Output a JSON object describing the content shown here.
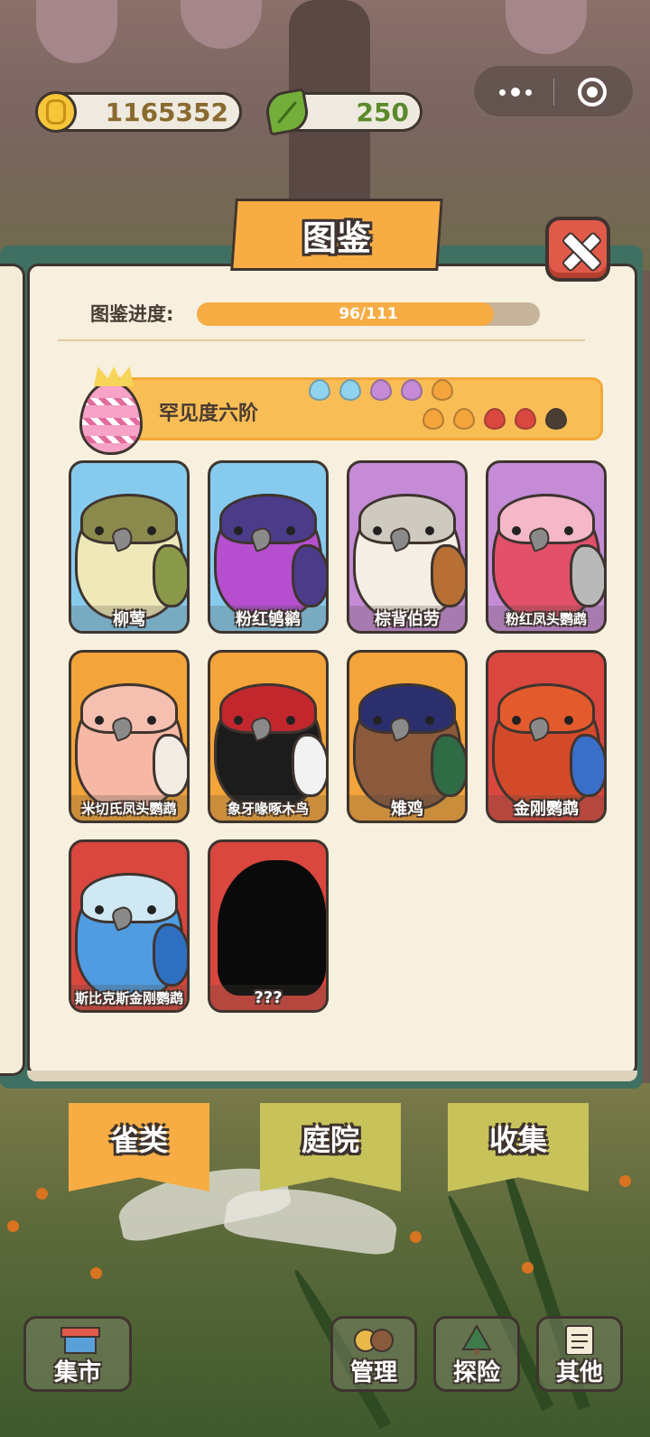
{
  "currency": {
    "coins": "1165352",
    "leaves": "250"
  },
  "pokedex": {
    "title": "图鉴",
    "progress_label": "图鉴进度:",
    "progress_text": "96/111",
    "progress_fraction": 0.865
  },
  "rarity": {
    "label": "罕见度六阶",
    "drop_colors": [
      "#8fd3ef",
      "#8fd3ef",
      "#c58bd6",
      "#c58bd6",
      "#f3a43a",
      "#f3a43a",
      "#f3a43a",
      "#d9473e",
      "#d9473e",
      "#4a3d33"
    ]
  },
  "birds": [
    {
      "name": "柳莺",
      "bg": "#86cbee",
      "body": "#efe8b9",
      "head": "#8a8a4c",
      "wing": "#8a9a4a",
      "found": true
    },
    {
      "name": "粉红鸲鹟",
      "bg": "#86cbee",
      "body": "#b54fcf",
      "head": "#4b3c8a",
      "wing": "#4b3c8a",
      "found": true
    },
    {
      "name": "棕背伯劳",
      "bg": "#c58bd6",
      "body": "#f4eee5",
      "head": "#cfcac0",
      "wing": "#b76f34",
      "found": true
    },
    {
      "name": "粉红凤头鹦鹉",
      "bg": "#c58bd6",
      "body": "#e2506a",
      "head": "#f4b8c8",
      "wing": "#b9b9b9",
      "found": true
    },
    {
      "name": "米切氏凤头鹦鹉",
      "bg": "#f3a43a",
      "body": "#f6b8a4",
      "head": "#f6c0b0",
      "wing": "#f2ebe4",
      "found": true
    },
    {
      "name": "象牙喙啄木鸟",
      "bg": "#f3a43a",
      "body": "#1c1c1c",
      "head": "#c1272d",
      "wing": "#f2f2f2",
      "found": true
    },
    {
      "name": "雉鸡",
      "bg": "#f3a43a",
      "body": "#8b5a3c",
      "head": "#2c2f6e",
      "wing": "#2f6b45",
      "found": true
    },
    {
      "name": "金刚鹦鹉",
      "bg": "#d9473e",
      "body": "#d24a2a",
      "head": "#e35a2c",
      "wing": "#3a6fc9",
      "found": true
    },
    {
      "name": "斯比克斯金刚鹦鹉",
      "bg": "#d9473e",
      "body": "#4f9ce0",
      "head": "#cfe8f4",
      "wing": "#2f6fbf",
      "found": true
    },
    {
      "name": "???",
      "bg": "#d9473e",
      "body": "#000000",
      "head": "#000000",
      "wing": "#000000",
      "found": false
    }
  ],
  "tabs": [
    {
      "label": "雀类",
      "active": true
    },
    {
      "label": "庭院",
      "active": false
    },
    {
      "label": "收集",
      "active": false
    }
  ],
  "nav": [
    {
      "label": "集市",
      "icon": "market-stall-icon"
    },
    {
      "label": "管理",
      "icon": "birds-manage-icon"
    },
    {
      "label": "探险",
      "icon": "tree-explore-icon"
    },
    {
      "label": "其他",
      "icon": "clipboard-icon"
    }
  ]
}
